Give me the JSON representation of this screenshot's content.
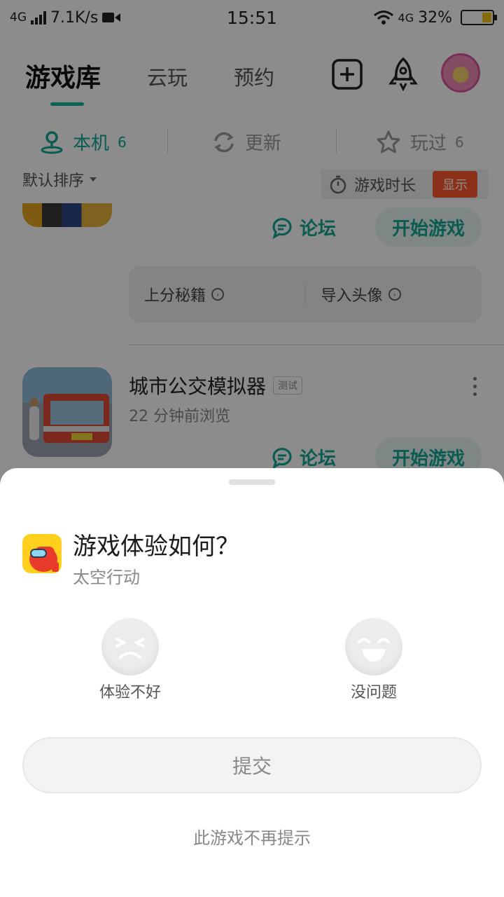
{
  "status_bar": {
    "network": "4G",
    "speed": "7.1K/s",
    "time": "15:51",
    "wifi_net": "4G",
    "battery": "32%"
  },
  "header": {
    "tab_library": "游戏库",
    "tab_cloud": "云玩",
    "tab_reserve": "预约",
    "accent_color": "#13b4a1"
  },
  "filters": {
    "local": {
      "label": "本机",
      "count": "6"
    },
    "update": {
      "label": "更新"
    },
    "played": {
      "label": "玩过",
      "count": "6"
    }
  },
  "sort": {
    "label": "默认排序"
  },
  "time_chip": {
    "label": "游戏时长",
    "toggle": "显示"
  },
  "list": {
    "game1": {
      "forum": "论坛",
      "play": "开始游戏",
      "tip1": "上分秘籍",
      "tip2": "导入头像"
    },
    "game2": {
      "title": "城市公交模拟器",
      "tag": "测试",
      "subtitle": "22 分钟前浏览",
      "forum": "论坛",
      "play": "开始游戏"
    }
  },
  "sheet": {
    "title": "游戏体验如何？",
    "game_name": "太空行动",
    "option_bad": "体验不好",
    "option_good": "没问题",
    "submit": "提交",
    "dont_show": "此游戏不再提示"
  }
}
